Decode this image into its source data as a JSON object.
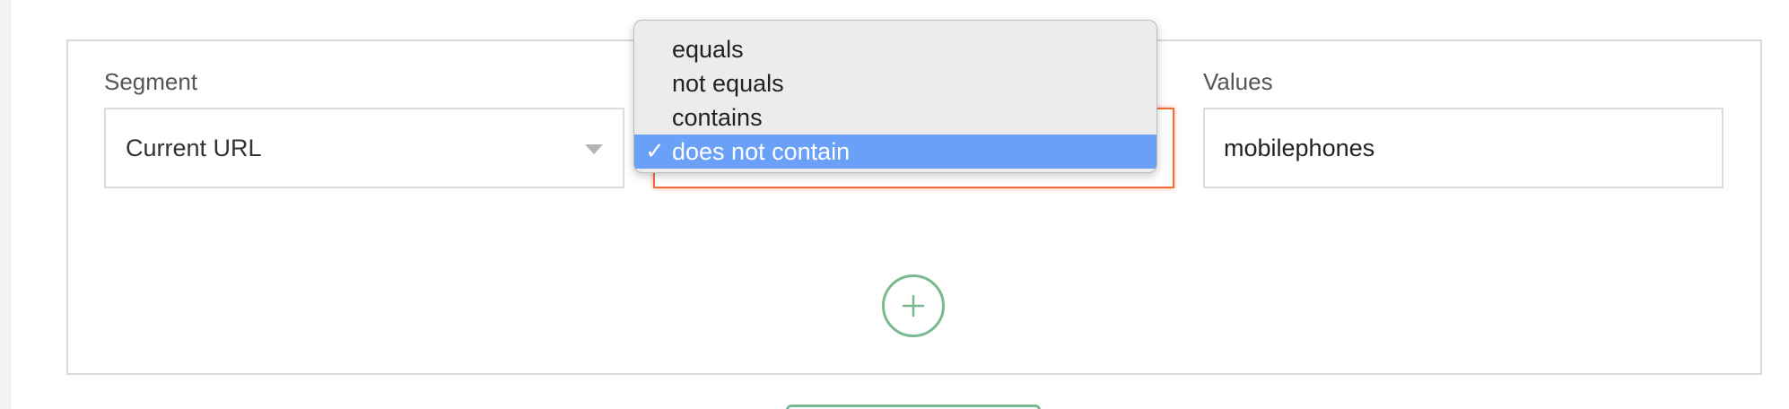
{
  "segment_rule": {
    "segment_label": "Segment",
    "segment_value": "Current URL",
    "values_label": "Values",
    "values_value": "mobilephones",
    "operator_dropdown": {
      "options": [
        {
          "label": "equals",
          "selected": false
        },
        {
          "label": "not equals",
          "selected": false
        },
        {
          "label": "contains",
          "selected": false
        },
        {
          "label": "does not contain",
          "selected": true
        }
      ],
      "check_glyph": "✓"
    },
    "add_button_glyph": "+"
  },
  "colors": {
    "focus_border": "#f26b3a",
    "selected_option_bg": "#6aa0f7",
    "add_button": "#7ab88f",
    "border": "#d9d9d9"
  },
  "icons": {
    "segment_caret": "chevron-down-icon",
    "add_button": "plus-icon",
    "selected_option": "check-icon"
  }
}
